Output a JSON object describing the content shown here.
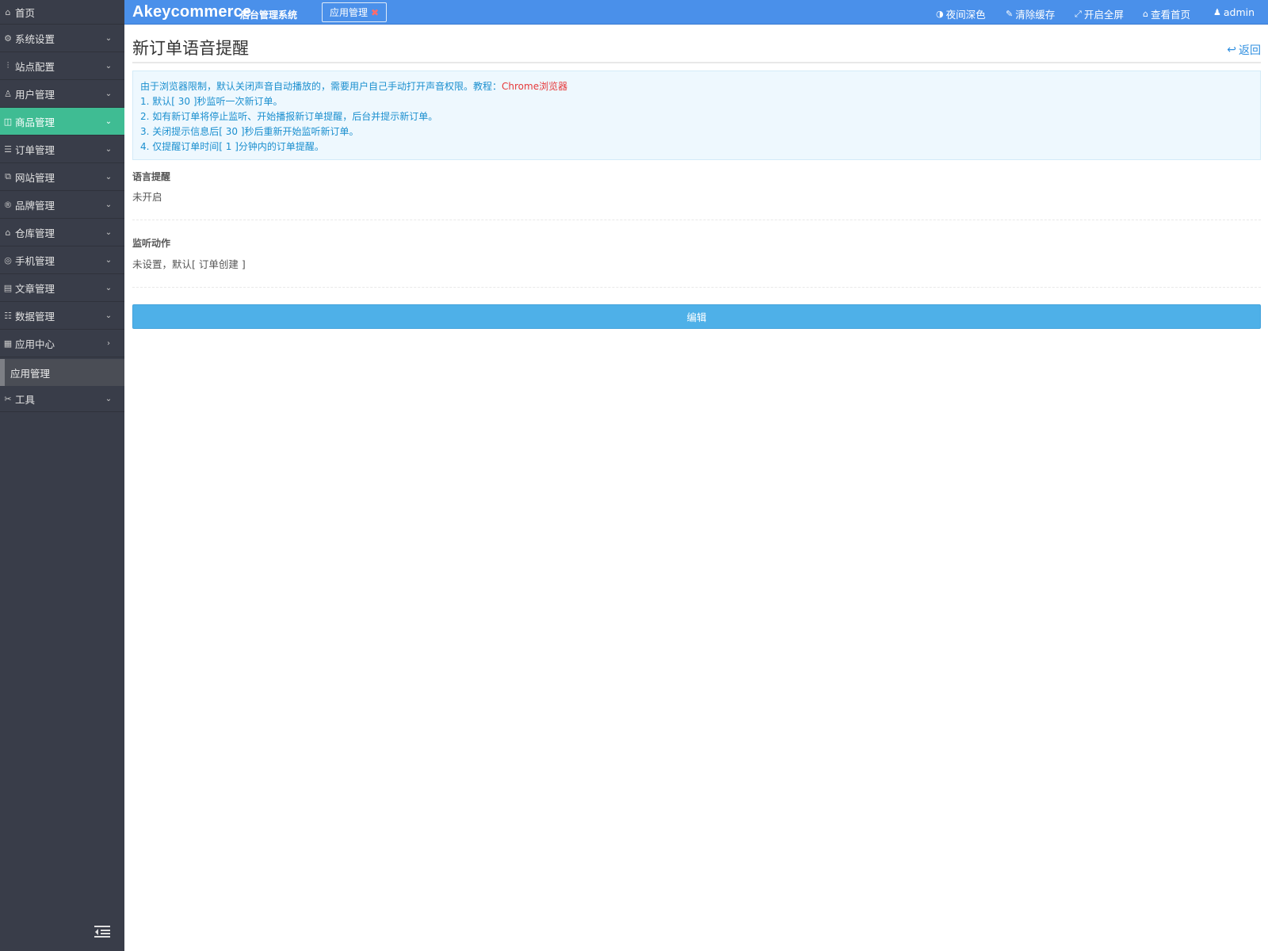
{
  "sidebar": {
    "home": {
      "label": "首页",
      "icon": "home-icon"
    },
    "items": [
      {
        "label": "系统设置",
        "icon": "gear-icon",
        "arrow": "chevron-down-icon"
      },
      {
        "label": "站点配置",
        "icon": "sliders-icon",
        "arrow": "chevron-down-icon"
      },
      {
        "label": "用户管理",
        "icon": "user-icon",
        "arrow": "chevron-down-icon"
      },
      {
        "label": "商品管理",
        "icon": "bag-icon",
        "arrow": "chevron-down-icon",
        "active": true
      },
      {
        "label": "订单管理",
        "icon": "list-icon",
        "arrow": "chevron-down-icon"
      },
      {
        "label": "网站管理",
        "icon": "website-icon",
        "arrow": "chevron-down-icon"
      },
      {
        "label": "品牌管理",
        "icon": "registered-icon",
        "arrow": "chevron-down-icon"
      },
      {
        "label": "仓库管理",
        "icon": "warehouse-icon",
        "arrow": "chevron-down-icon"
      },
      {
        "label": "手机管理",
        "icon": "mobile-icon",
        "arrow": "chevron-down-icon"
      },
      {
        "label": "文章管理",
        "icon": "document-icon",
        "arrow": "chevron-down-icon"
      },
      {
        "label": "数据管理",
        "icon": "database-icon",
        "arrow": "chevron-down-icon"
      },
      {
        "label": "应用中心",
        "icon": "apps-icon",
        "arrow": "chevron-right-icon"
      }
    ],
    "sub_item": {
      "label": "应用管理"
    },
    "tools": {
      "label": "工具",
      "icon": "tools-icon",
      "arrow": "chevron-down-icon"
    }
  },
  "header": {
    "brand": "Akeycommerce",
    "brand_sub": "后台管理系统",
    "tab_label": "应用管理",
    "tab_close": "✖",
    "links": [
      {
        "label": "夜间深色",
        "icon": "contrast-icon"
      },
      {
        "label": "清除缓存",
        "icon": "brush-icon"
      },
      {
        "label": "开启全屏",
        "icon": "fullscreen-icon"
      },
      {
        "label": "查看首页",
        "icon": "home-icon"
      },
      {
        "label": "admin",
        "icon": "user-icon"
      }
    ]
  },
  "main": {
    "title": "新订单语音提醒",
    "back_label": "返回",
    "notice": {
      "line0_prefix": "由于浏览器限制，默认关闭声音自动播放的，需要用户自己手动打开声音权限。教程：",
      "line0_link": "Chrome浏览器",
      "lines": [
        "1. 默认[ 30 ]秒监听一次新订单。",
        "2. 如有新订单将停止监听、开始播报新订单提醒，后台并提示新订单。",
        "3. 关闭提示信息后[ 30 ]秒后重新开始监听新订单。",
        "4. 仅提醒订单时间[ 1 ]分钟内的订单提醒。"
      ]
    },
    "fields": [
      {
        "label": "语言提醒",
        "value": "未开启"
      },
      {
        "label": "监听动作",
        "value": "未设置，默认[ 订单创建 ]"
      }
    ],
    "edit_label": "编辑"
  },
  "colors": {
    "header_bg": "#4a90ea",
    "sidebar_bg": "#393d49",
    "active_bg": "#3fbc93",
    "button_bg": "#4eb0e8",
    "notice_text": "#1b8fcf",
    "link_red": "#e6393a"
  }
}
